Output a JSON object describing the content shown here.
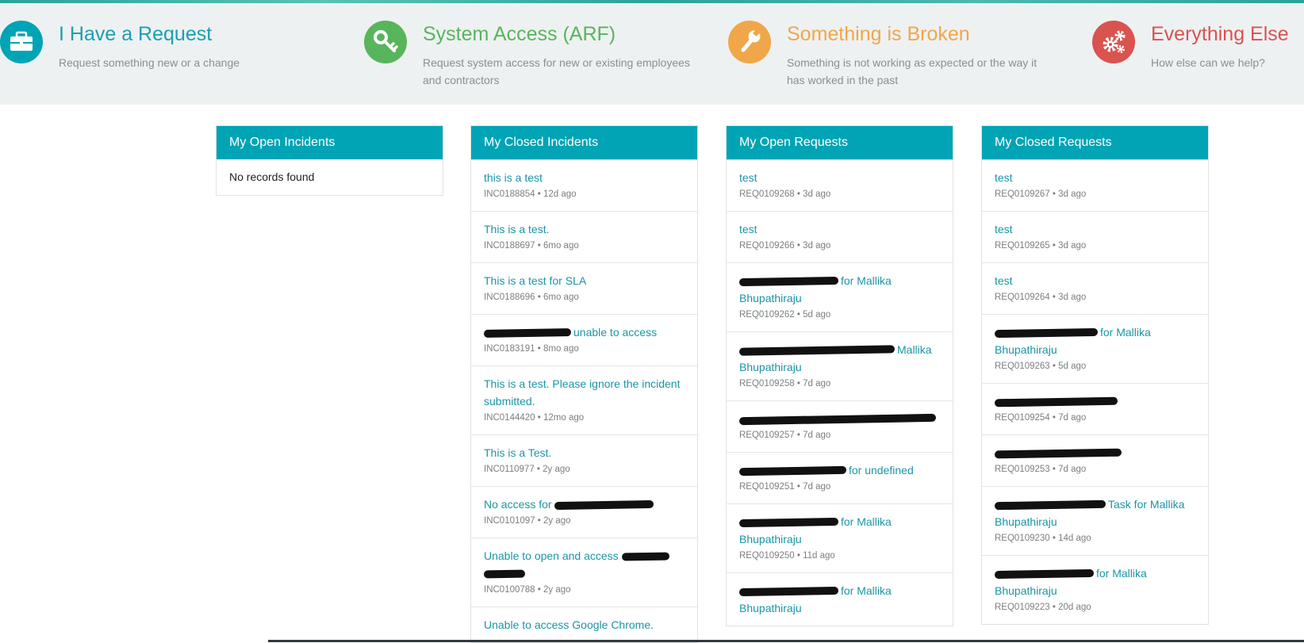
{
  "colors": {
    "teal": "#00a4b5",
    "green": "#58b55b",
    "orange": "#f0a749",
    "red": "#d9534f",
    "link": "#1a95a6"
  },
  "tiles": [
    {
      "icon": "briefcase-icon",
      "title": "I Have a Request",
      "desc": "Request something new or a change"
    },
    {
      "icon": "key-icon",
      "title": "System Access (ARF)",
      "desc": "Request system access for new or existing employees and contractors"
    },
    {
      "icon": "wrench-icon",
      "title": "Something is Broken",
      "desc": "Something is not working as expected or the way it has worked in the past"
    },
    {
      "icon": "gears-icon",
      "title": "Everything Else",
      "desc": "How else can we help?"
    }
  ],
  "open_incidents": {
    "heading": "My Open Incidents",
    "empty": "No records found"
  },
  "closed_incidents": {
    "heading": "My Closed Incidents",
    "items": [
      {
        "title": "this is a test",
        "meta": "INC0188854 • 12d ago"
      },
      {
        "title": "This is a test.",
        "meta": "INC0188697 • 6mo ago"
      },
      {
        "title": "This is a test for SLA",
        "meta": "INC0188696 • 6mo ago"
      },
      {
        "title": "unable to access",
        "meta": "INC0183191 • 8mo ago"
      },
      {
        "title": "This is a test. Please ignore the incident submitted.",
        "meta": "INC0144420 • 12mo ago"
      },
      {
        "title": "This is a Test.",
        "meta": "INC0110977 • 2y ago"
      },
      {
        "title": "No access for",
        "meta": "INC0101097 • 2y ago"
      },
      {
        "title": "Unable to open and access",
        "meta": "INC0100788 • 2y ago"
      },
      {
        "title": "Unable to access Google Chrome.",
        "meta": ""
      }
    ]
  },
  "open_requests": {
    "heading": "My Open Requests",
    "items": [
      {
        "title": "test",
        "meta": "REQ0109268 • 3d ago"
      },
      {
        "title": "test",
        "meta": "REQ0109266 • 3d ago"
      },
      {
        "title": "for Mallika Bhupathiraju",
        "meta": "REQ0109262 • 5d ago"
      },
      {
        "title": "Mallika Bhupathiraju",
        "meta": "REQ0109258 • 7d ago"
      },
      {
        "title": "",
        "meta": "REQ0109257 • 7d ago"
      },
      {
        "title": "for undefined",
        "meta": "REQ0109251 • 7d ago"
      },
      {
        "title": "for Mallika Bhupathiraju",
        "meta": "REQ0109250 • 11d ago"
      },
      {
        "title": "for Mallika Bhupathiraju",
        "meta": ""
      }
    ]
  },
  "closed_requests": {
    "heading": "My Closed Requests",
    "items": [
      {
        "title": "test",
        "meta": "REQ0109267 • 3d ago"
      },
      {
        "title": "test",
        "meta": "REQ0109265 • 3d ago"
      },
      {
        "title": "test",
        "meta": "REQ0109264 • 3d ago"
      },
      {
        "title": "for Mallika Bhupathiraju",
        "meta": "REQ0109263 • 5d ago"
      },
      {
        "title": "",
        "meta": "REQ0109254 • 7d ago"
      },
      {
        "title": "",
        "meta": "REQ0109253 • 7d ago"
      },
      {
        "title": "Task for Mallika Bhupathiraju",
        "meta": "REQ0109230 • 14d ago"
      },
      {
        "title": "for Mallika Bhupathiraju",
        "meta": "REQ0109223 • 20d ago"
      }
    ]
  }
}
